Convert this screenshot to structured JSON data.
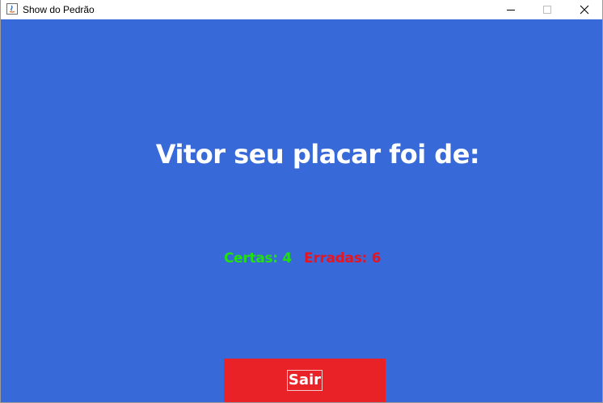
{
  "window": {
    "title": "Show do Pedrão",
    "controls": {
      "minimize_icon": "minimize-icon",
      "maximize_icon": "maximize-icon",
      "close_icon": "close-icon"
    }
  },
  "result": {
    "heading": "Vitor seu placar foi de:",
    "certas_label": "Certas: 4",
    "erradas_label": "Erradas: 6"
  },
  "actions": {
    "exit_label": "Sair"
  },
  "colors": {
    "background": "#3869d8",
    "certas": "#22e010",
    "erradas": "#e8141e",
    "exit_button": "#e82227",
    "heading": "#ffffff"
  }
}
